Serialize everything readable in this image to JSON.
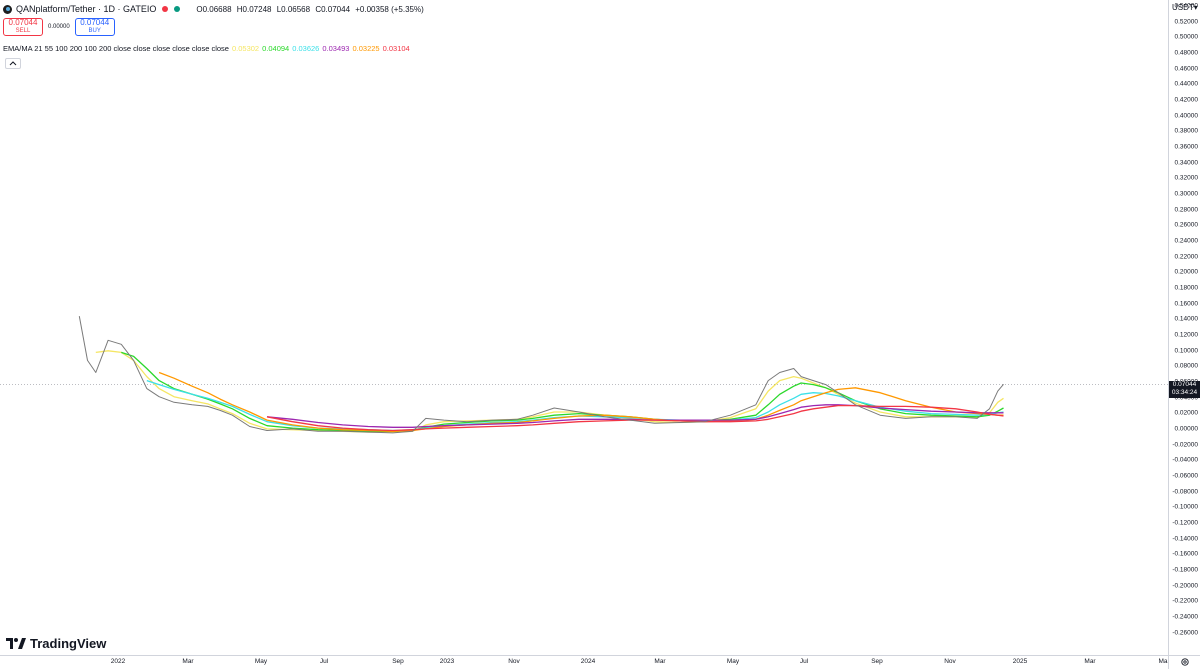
{
  "header": {
    "symbol": "QANplatform/Tether · 1D · GATEIO",
    "ohlc": {
      "open_label": "O",
      "open": "0.06688",
      "high_label": "H",
      "high": "0.07248",
      "low_label": "L",
      "low": "0.06568",
      "close_label": "C",
      "close": "0.07044",
      "change": "+0.00358 (+5.35%)"
    },
    "status_colors": [
      "#f23645",
      "#089981"
    ]
  },
  "trade": {
    "sell_price": "0.07044",
    "sell_label": "SELL",
    "spread": "0.00000",
    "buy_price": "0.07044",
    "buy_label": "BUY"
  },
  "indicator": {
    "title": "EMA/MA 21 55 100 200 100 200 close close close close close close",
    "values": [
      {
        "value": "0.05302",
        "color": "#f5e663"
      },
      {
        "value": "0.04094",
        "color": "#2bd82b"
      },
      {
        "value": "0.03626",
        "color": "#3ce0e8"
      },
      {
        "value": "0.03493",
        "color": "#9c27b0"
      },
      {
        "value": "0.03225",
        "color": "#ff9800"
      },
      {
        "value": "0.03104",
        "color": "#f23645"
      }
    ],
    "collapse_icon": "chevron-up-icon"
  },
  "price_axis": {
    "currency": "USDT",
    "labels": [
      "0.54000",
      "0.52000",
      "0.50000",
      "0.48000",
      "0.46000",
      "0.44000",
      "0.42000",
      "0.40000",
      "0.38000",
      "0.36000",
      "0.34000",
      "0.32000",
      "0.30000",
      "0.28000",
      "0.26000",
      "0.24000",
      "0.22000",
      "0.20000",
      "0.18000",
      "0.16000",
      "0.14000",
      "0.12000",
      "0.10000",
      "0.08000",
      "0.06000",
      "0.04000",
      "0.02000",
      "0.00000",
      "-0.02000",
      "-0.04000",
      "-0.06000",
      "-0.08000",
      "-0.10000",
      "-0.12000",
      "-0.14000",
      "-0.16000",
      "-0.18000",
      "-0.20000",
      "-0.22000",
      "-0.24000",
      "-0.26000"
    ],
    "current_price": "0.07044",
    "countdown": "03:34:24"
  },
  "time_axis": {
    "labels": [
      "2022",
      "Mar",
      "May",
      "Jul",
      "Sep",
      "2023",
      "Nov",
      "2024",
      "Mar",
      "May",
      "Jul",
      "Sep",
      "Nov",
      "2025",
      "Mar",
      "Ma"
    ]
  },
  "branding": {
    "logo_text": "TradingView"
  },
  "chart_data": {
    "type": "line",
    "title": "QANplatform/Tether · 1D · GATEIO",
    "xlabel": "",
    "ylabel": "USDT",
    "ylim": [
      -0.27,
      0.55
    ],
    "grid": false,
    "x": [
      "2021-11-15",
      "2021-11-25",
      "2021-12-05",
      "2021-12-20",
      "2022-01-05",
      "2022-01-20",
      "2022-02-05",
      "2022-02-20",
      "2022-03-10",
      "2022-04-01",
      "2022-04-20",
      "2022-05-05",
      "2022-05-20",
      "2022-06-10",
      "2022-07-01",
      "2022-08-01",
      "2022-09-01",
      "2022-10-01",
      "2022-11-01",
      "2022-12-01",
      "2022-12-25",
      "2023-01-10",
      "2023-02-01",
      "2023-03-01",
      "2023-04-01",
      "2023-05-01",
      "2023-05-20",
      "2023-06-15",
      "2023-07-15",
      "2023-08-15",
      "2023-09-15",
      "2023-10-15",
      "2023-11-15",
      "2023-12-15",
      "2024-01-15",
      "2024-02-15",
      "2024-03-01",
      "2024-03-15",
      "2024-04-01",
      "2024-04-10",
      "2024-04-25",
      "2024-05-10",
      "2024-05-25",
      "2024-06-15",
      "2024-07-15",
      "2024-08-15",
      "2024-09-15",
      "2024-10-15",
      "2024-11-10",
      "2024-11-25",
      "2024-12-05",
      "2024-12-12"
    ],
    "series": [
      {
        "type": "close",
        "color": "#7a7a7a",
        "values": [
          0.155,
          0.1,
          0.085,
          0.125,
          0.12,
          0.1,
          0.065,
          0.055,
          0.048,
          0.045,
          0.043,
          0.038,
          0.032,
          0.018,
          0.013,
          0.015,
          0.012,
          0.012,
          0.011,
          0.01,
          0.012,
          0.028,
          0.026,
          0.024,
          0.026,
          0.027,
          0.032,
          0.041,
          0.036,
          0.03,
          0.026,
          0.022,
          0.023,
          0.024,
          0.032,
          0.045,
          0.075,
          0.085,
          0.09,
          0.08,
          0.075,
          0.07,
          0.06,
          0.045,
          0.032,
          0.028,
          0.03,
          0.03,
          0.028,
          0.04,
          0.062,
          0.0704
        ]
      },
      {
        "name": "",
        "type": "ema21",
        "color": "#f5e663",
        "values": [
          null,
          null,
          0.11,
          0.112,
          0.11,
          0.1,
          0.08,
          0.065,
          0.055,
          0.05,
          0.046,
          0.04,
          0.034,
          0.022,
          0.015,
          0.014,
          0.013,
          0.012,
          0.011,
          0.011,
          0.012,
          0.02,
          0.024,
          0.025,
          0.026,
          0.027,
          0.03,
          0.036,
          0.036,
          0.032,
          0.028,
          0.024,
          0.023,
          0.024,
          0.029,
          0.04,
          0.062,
          0.075,
          0.08,
          0.078,
          0.072,
          0.066,
          0.058,
          0.047,
          0.036,
          0.03,
          0.03,
          0.03,
          0.029,
          0.035,
          0.048,
          0.053
        ]
      },
      {
        "name": "",
        "type": "ema55",
        "color": "#2bd82b",
        "values": [
          null,
          null,
          null,
          null,
          0.11,
          0.105,
          0.09,
          0.075,
          0.065,
          0.058,
          0.052,
          0.046,
          0.04,
          0.028,
          0.019,
          0.016,
          0.014,
          0.013,
          0.012,
          0.012,
          0.013,
          0.017,
          0.021,
          0.023,
          0.025,
          0.026,
          0.028,
          0.032,
          0.034,
          0.032,
          0.03,
          0.027,
          0.025,
          0.025,
          0.027,
          0.032,
          0.045,
          0.058,
          0.068,
          0.072,
          0.07,
          0.066,
          0.06,
          0.05,
          0.04,
          0.034,
          0.032,
          0.031,
          0.03,
          0.032,
          0.037,
          0.041
        ]
      },
      {
        "name": "",
        "type": "ema100",
        "color": "#3ce0e8",
        "values": [
          null,
          null,
          null,
          null,
          null,
          null,
          0.075,
          0.07,
          0.064,
          0.058,
          0.053,
          0.048,
          0.043,
          0.033,
          0.024,
          0.019,
          0.016,
          0.015,
          0.014,
          0.013,
          0.014,
          0.016,
          0.019,
          0.021,
          0.023,
          0.024,
          0.026,
          0.029,
          0.031,
          0.03,
          0.029,
          0.027,
          0.026,
          0.025,
          0.026,
          0.029,
          0.036,
          0.045,
          0.053,
          0.058,
          0.06,
          0.059,
          0.056,
          0.05,
          0.042,
          0.037,
          0.034,
          0.033,
          0.032,
          0.033,
          0.035,
          0.036
        ]
      },
      {
        "name": "",
        "type": "ma100",
        "color": "#ff9800",
        "values": [
          null,
          null,
          null,
          null,
          null,
          null,
          null,
          0.085,
          0.078,
          0.068,
          0.06,
          0.052,
          0.045,
          0.036,
          0.026,
          0.02,
          0.016,
          0.014,
          0.013,
          0.012,
          0.013,
          0.015,
          0.018,
          0.02,
          0.022,
          0.023,
          0.025,
          0.028,
          0.031,
          0.032,
          0.03,
          0.027,
          0.025,
          0.024,
          0.025,
          0.027,
          0.032,
          0.038,
          0.045,
          0.05,
          0.055,
          0.06,
          0.064,
          0.066,
          0.06,
          0.05,
          0.042,
          0.036,
          0.034,
          0.033,
          0.032,
          0.032
        ]
      },
      {
        "name": "",
        "type": "ema200",
        "color": "#9c27b0",
        "values": [
          null,
          null,
          null,
          null,
          null,
          null,
          null,
          null,
          null,
          null,
          null,
          null,
          null,
          null,
          0.03,
          0.027,
          0.023,
          0.02,
          0.018,
          0.017,
          0.017,
          0.018,
          0.019,
          0.02,
          0.021,
          0.022,
          0.023,
          0.025,
          0.027,
          0.027,
          0.027,
          0.026,
          0.026,
          0.026,
          0.026,
          0.027,
          0.03,
          0.034,
          0.039,
          0.042,
          0.044,
          0.045,
          0.045,
          0.044,
          0.041,
          0.039,
          0.037,
          0.036,
          0.035,
          0.035,
          0.035,
          0.035
        ]
      },
      {
        "name": "",
        "type": "ma200",
        "color": "#f23645",
        "values": [
          null,
          null,
          null,
          null,
          null,
          null,
          null,
          null,
          null,
          null,
          null,
          null,
          null,
          null,
          0.03,
          0.024,
          0.019,
          0.016,
          0.014,
          0.013,
          0.014,
          0.015,
          0.016,
          0.017,
          0.018,
          0.019,
          0.02,
          0.022,
          0.024,
          0.025,
          0.026,
          0.026,
          0.025,
          0.024,
          0.024,
          0.025,
          0.027,
          0.03,
          0.034,
          0.037,
          0.04,
          0.042,
          0.044,
          0.044,
          0.043,
          0.043,
          0.042,
          0.04,
          0.036,
          0.033,
          0.032,
          0.031
        ]
      }
    ]
  }
}
